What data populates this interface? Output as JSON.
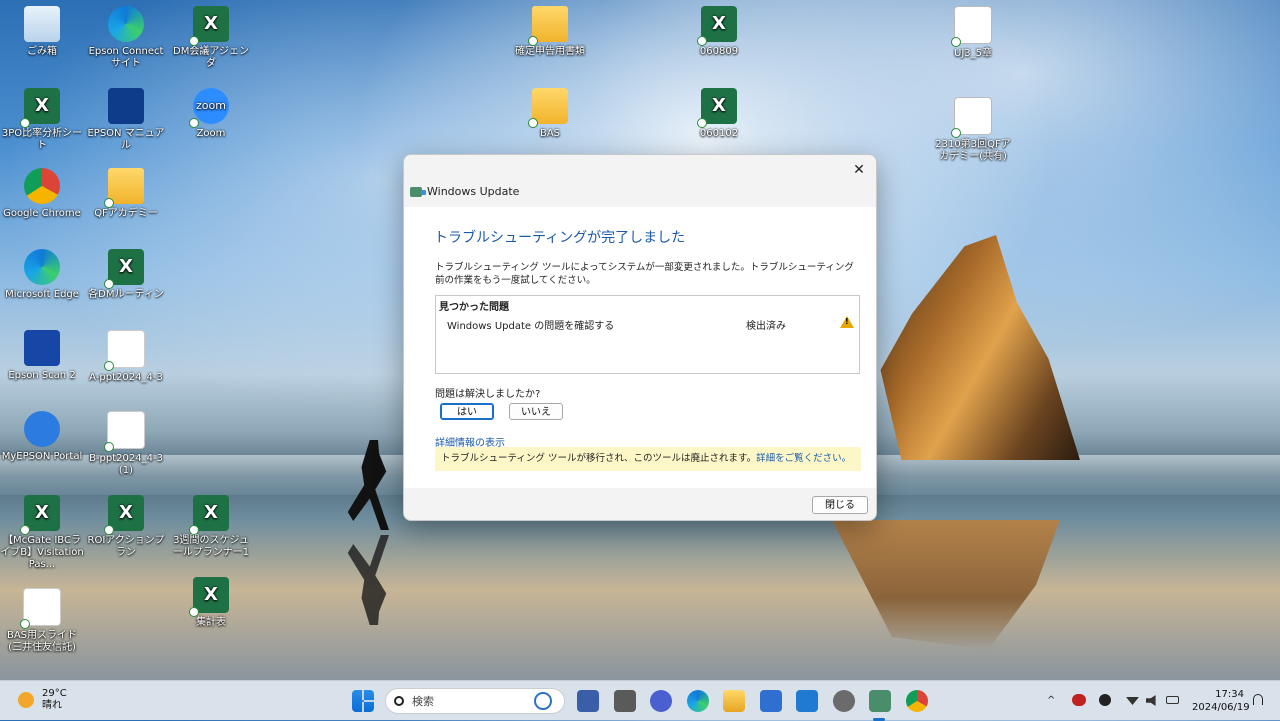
{
  "desktop": {
    "icons": [
      {
        "label": "ごみ箱"
      },
      {
        "label": "Epson Connect サイト"
      },
      {
        "label": "DM会議アジェンダ"
      },
      {
        "label": "3PO比率分析シート"
      },
      {
        "label": "EPSON マニュアル"
      },
      {
        "label": "Zoom"
      },
      {
        "label": "Google Chrome"
      },
      {
        "label": "QFアカデミー"
      },
      {
        "label": "Microsoft Edge"
      },
      {
        "label": "各DMルーティン"
      },
      {
        "label": "Epson Scan 2"
      },
      {
        "label": "A-ppt2024_4-3"
      },
      {
        "label": "MyEPSON Portal"
      },
      {
        "label": "B-ppt2024_4-3 (1)"
      },
      {
        "label": "【McGate IBCライブB】Visitation Pas..."
      },
      {
        "label": "ROIアクションプラン"
      },
      {
        "label": "3週間のスケジュールプランナー1"
      },
      {
        "label": "BAS用スライド (三井住友信託)"
      },
      {
        "label": "集計表"
      },
      {
        "label": "確定申告用書類"
      },
      {
        "label": "BAS"
      },
      {
        "label": "060809"
      },
      {
        "label": "060102"
      },
      {
        "label": "UJ3_5章"
      },
      {
        "label": "2310第3回QFアカデミー(共有)"
      }
    ]
  },
  "dialog": {
    "window_title": "Windows Update",
    "close_glyph": "✕",
    "heading": "トラブルシューティングが完了しました",
    "description": "トラブルシューティング ツールによってシステムが一部変更されました。トラブルシューティング前の作業をもう一度試してください。",
    "problems_header": "見つかった問題",
    "problem_name": "Windows Update の問題を確認する",
    "problem_status": "検出済み",
    "warning_glyph": "!",
    "question": "問題は解決しましたか?",
    "yes_label": "はい",
    "no_label": "いいえ",
    "details_link": "詳細情報の表示",
    "notice_text": "トラブルシューティング ツールが移行され、このツールは廃止されます。",
    "notice_link": "詳細をご覧ください。",
    "close_button": "閉じる"
  },
  "taskbar": {
    "temperature": "29°C",
    "weather": "晴れ",
    "search_placeholder": "検索",
    "time": "17:34",
    "date": "2024/06/19",
    "tray_chevron": "^"
  },
  "colors": {
    "accent": "#1a6fc9",
    "heading": "#1a5aa8",
    "notice_bg": "#fdf7c8",
    "excel": "#1e7145"
  }
}
